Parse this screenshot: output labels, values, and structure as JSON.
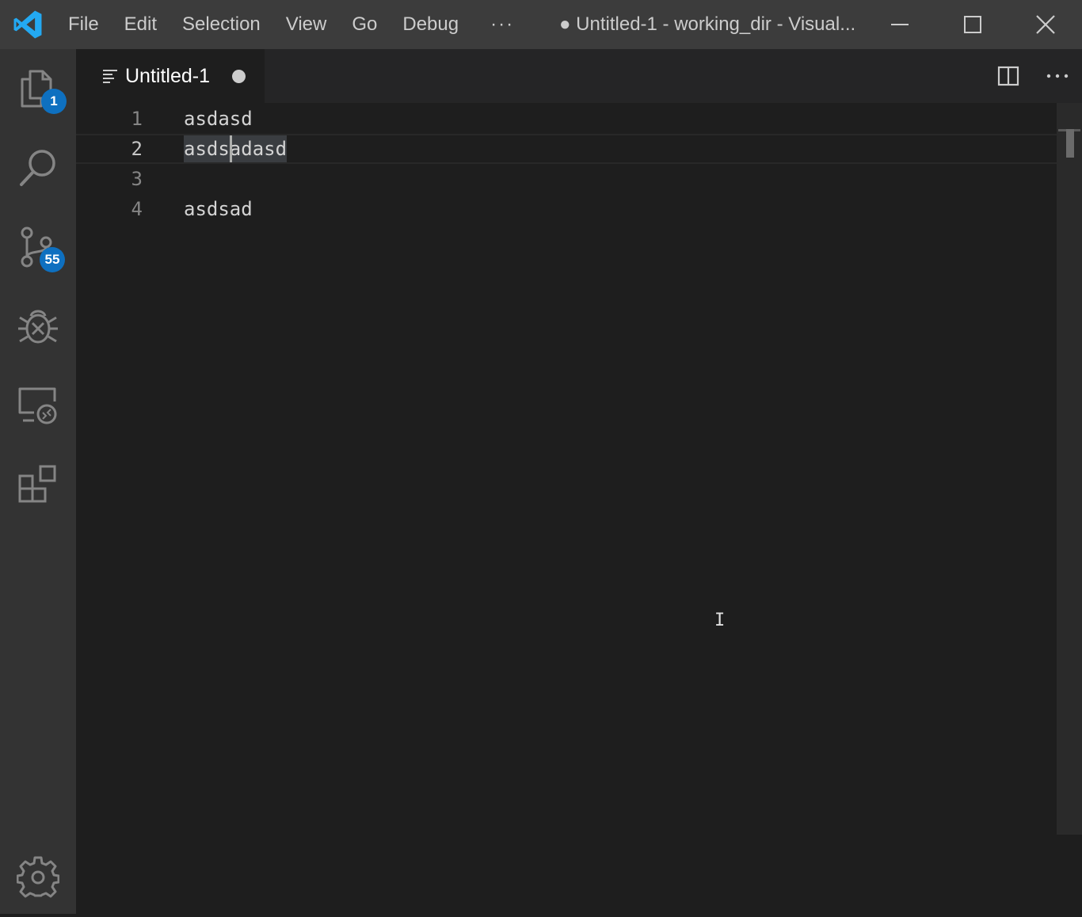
{
  "titlebar": {
    "menu": [
      "File",
      "Edit",
      "Selection",
      "View",
      "Go",
      "Debug",
      "···"
    ],
    "window_title": "● Untitled-1 - working_dir - Visual...",
    "logo_icon": "vscode-logo-icon",
    "brand_color": "#23a9f2"
  },
  "activitybar": {
    "items": [
      {
        "name": "explorer",
        "icon": "files-icon",
        "badge": "1"
      },
      {
        "name": "search",
        "icon": "search-icon"
      },
      {
        "name": "source-control",
        "icon": "source-control-icon",
        "badge": "55"
      },
      {
        "name": "debug",
        "icon": "debug-icon"
      },
      {
        "name": "remote-explorer",
        "icon": "remote-explorer-icon"
      },
      {
        "name": "extensions",
        "icon": "extensions-icon"
      },
      {
        "name": "manage",
        "icon": "gear-icon"
      }
    ],
    "badge_color": "#0e70c0"
  },
  "tabs": [
    {
      "title": "Untitled-1",
      "dirty": true,
      "active": true
    }
  ],
  "editor": {
    "lines": [
      {
        "number": "1",
        "text": "asdasd"
      },
      {
        "number": "2",
        "text_before_cursor": "asds",
        "text_after_cursor": "adasd",
        "current": true
      },
      {
        "number": "3",
        "text": ""
      },
      {
        "number": "4",
        "text": "asdsad"
      }
    ],
    "cursor_glyph": "I"
  }
}
